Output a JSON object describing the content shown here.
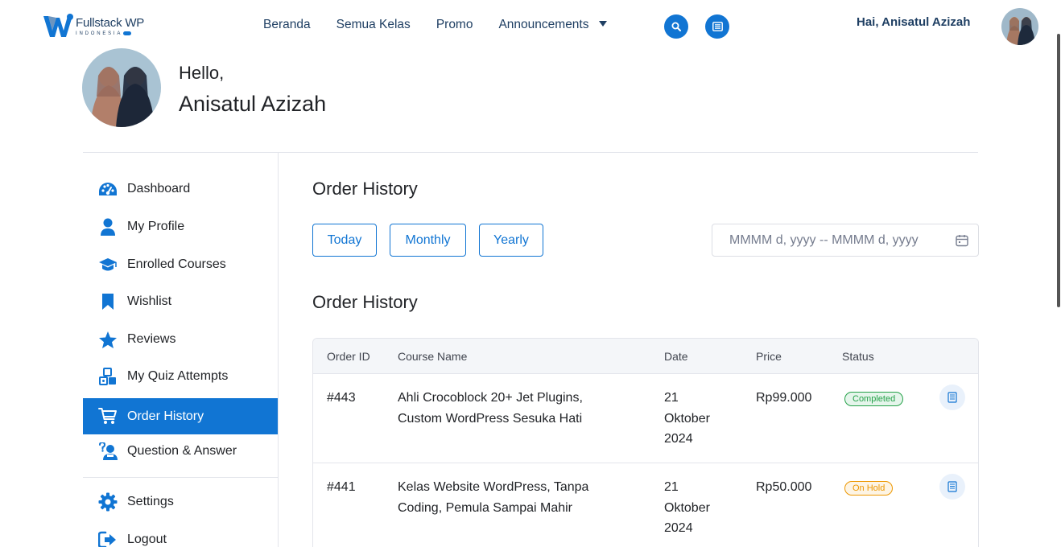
{
  "brand": {
    "name": "Fullstack WP",
    "subtitle": "INDONESIA"
  },
  "nav": {
    "items": [
      "Beranda",
      "Semua Kelas",
      "Promo",
      "Announcements"
    ],
    "search_icon": "search-icon",
    "list_icon": "list-alt-icon",
    "greeting": "Hai, Anisatul Azizah"
  },
  "profile": {
    "hello": "Hello,",
    "name": "Anisatul Azizah"
  },
  "sidebar": {
    "items": [
      {
        "label": "Dashboard",
        "icon": "dashboard-icon"
      },
      {
        "label": "My Profile",
        "icon": "user-icon"
      },
      {
        "label": "Enrolled Courses",
        "icon": "graduation-cap-icon"
      },
      {
        "label": "Wishlist",
        "icon": "bookmark-icon"
      },
      {
        "label": "Reviews",
        "icon": "star-icon"
      },
      {
        "label": "My Quiz Attempts",
        "icon": "quiz-icon"
      },
      {
        "label": "Order History",
        "icon": "cart-icon",
        "active": true
      },
      {
        "label": "Question & Answer",
        "icon": "question-user-icon"
      },
      {
        "label": "Settings",
        "icon": "gear-icon"
      },
      {
        "label": "Logout",
        "icon": "logout-icon"
      }
    ]
  },
  "main": {
    "title": "Order History",
    "filters": [
      "Today",
      "Monthly",
      "Yearly"
    ],
    "date_range_placeholder": "MMMM d, yyyy -- MMMM d, yyyy",
    "section_title": "Order History"
  },
  "table": {
    "headers": [
      "Order ID",
      "Course Name",
      "Date",
      "Price",
      "Status"
    ],
    "rows": [
      {
        "id": "#443",
        "course_line1": "Ahli Crocoblock 20+ Jet Plugins,",
        "course_line2": "Custom WordPress Sesuka Hati",
        "date_line1": "21",
        "date_line2": "Oktober",
        "date_line3": "2024",
        "price": "Rp99.000",
        "status": "Completed"
      },
      {
        "id": "#441",
        "course_line1": "Kelas Website WordPress, Tanpa",
        "course_line2": "Coding, Pemula Sampai Mahir",
        "date_line1": "21",
        "date_line2": "Oktober",
        "date_line3": "2024",
        "price": "Rp50.000",
        "status": "On Hold"
      }
    ]
  },
  "colors": {
    "primary": "#1175d3",
    "text": "#212327",
    "nav_text": "#1f3f63",
    "completed": "#24a148",
    "on_hold": "#ed9700"
  }
}
